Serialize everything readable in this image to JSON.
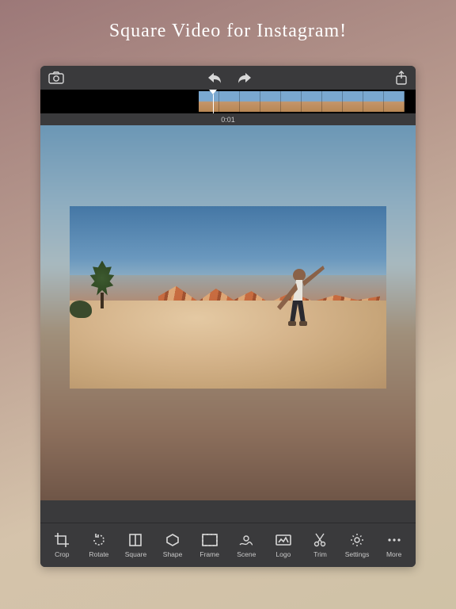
{
  "promo": {
    "title": "Square Video for Instagram!"
  },
  "timecode": "0:01",
  "toolbar": [
    {
      "id": "crop",
      "label": "Crop"
    },
    {
      "id": "rotate",
      "label": "Rotate"
    },
    {
      "id": "square",
      "label": "Square"
    },
    {
      "id": "shape",
      "label": "Shape"
    },
    {
      "id": "frame",
      "label": "Frame"
    },
    {
      "id": "scene",
      "label": "Scene"
    },
    {
      "id": "logo",
      "label": "Logo"
    },
    {
      "id": "trim",
      "label": "Trim"
    },
    {
      "id": "settings",
      "label": "Settings"
    },
    {
      "id": "more",
      "label": "More"
    }
  ],
  "topbar": {
    "camera": "camera-icon",
    "undo": "undo-icon",
    "redo": "redo-icon",
    "share": "share-icon"
  }
}
